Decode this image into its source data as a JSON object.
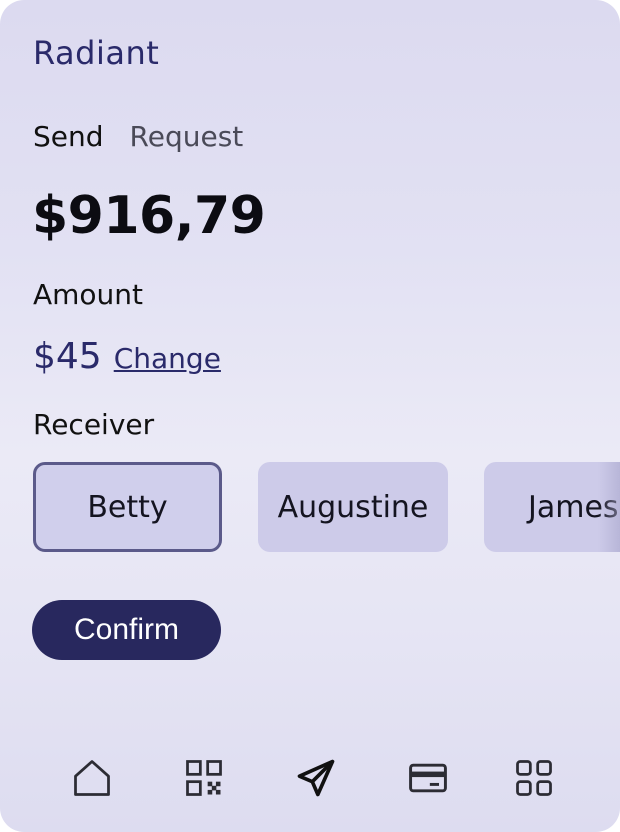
{
  "app": {
    "name": "Radiant"
  },
  "tabs": [
    {
      "label": "Send",
      "active": true
    },
    {
      "label": "Request",
      "active": false
    }
  ],
  "balance": "$916,79",
  "amount": {
    "label": "Amount",
    "value": "$45",
    "change_label": "Change"
  },
  "receiver": {
    "label": "Receiver",
    "options": [
      "Betty",
      "Augustine",
      "James"
    ],
    "selected": "Betty"
  },
  "confirm_label": "Confirm",
  "nav": {
    "items": [
      "home-icon",
      "qr-code-icon",
      "send-icon",
      "card-icon",
      "grid-icon"
    ]
  },
  "colors": {
    "accent": "#28285e",
    "brand": "#2a2a6a",
    "chip": "#cdcbe9"
  }
}
